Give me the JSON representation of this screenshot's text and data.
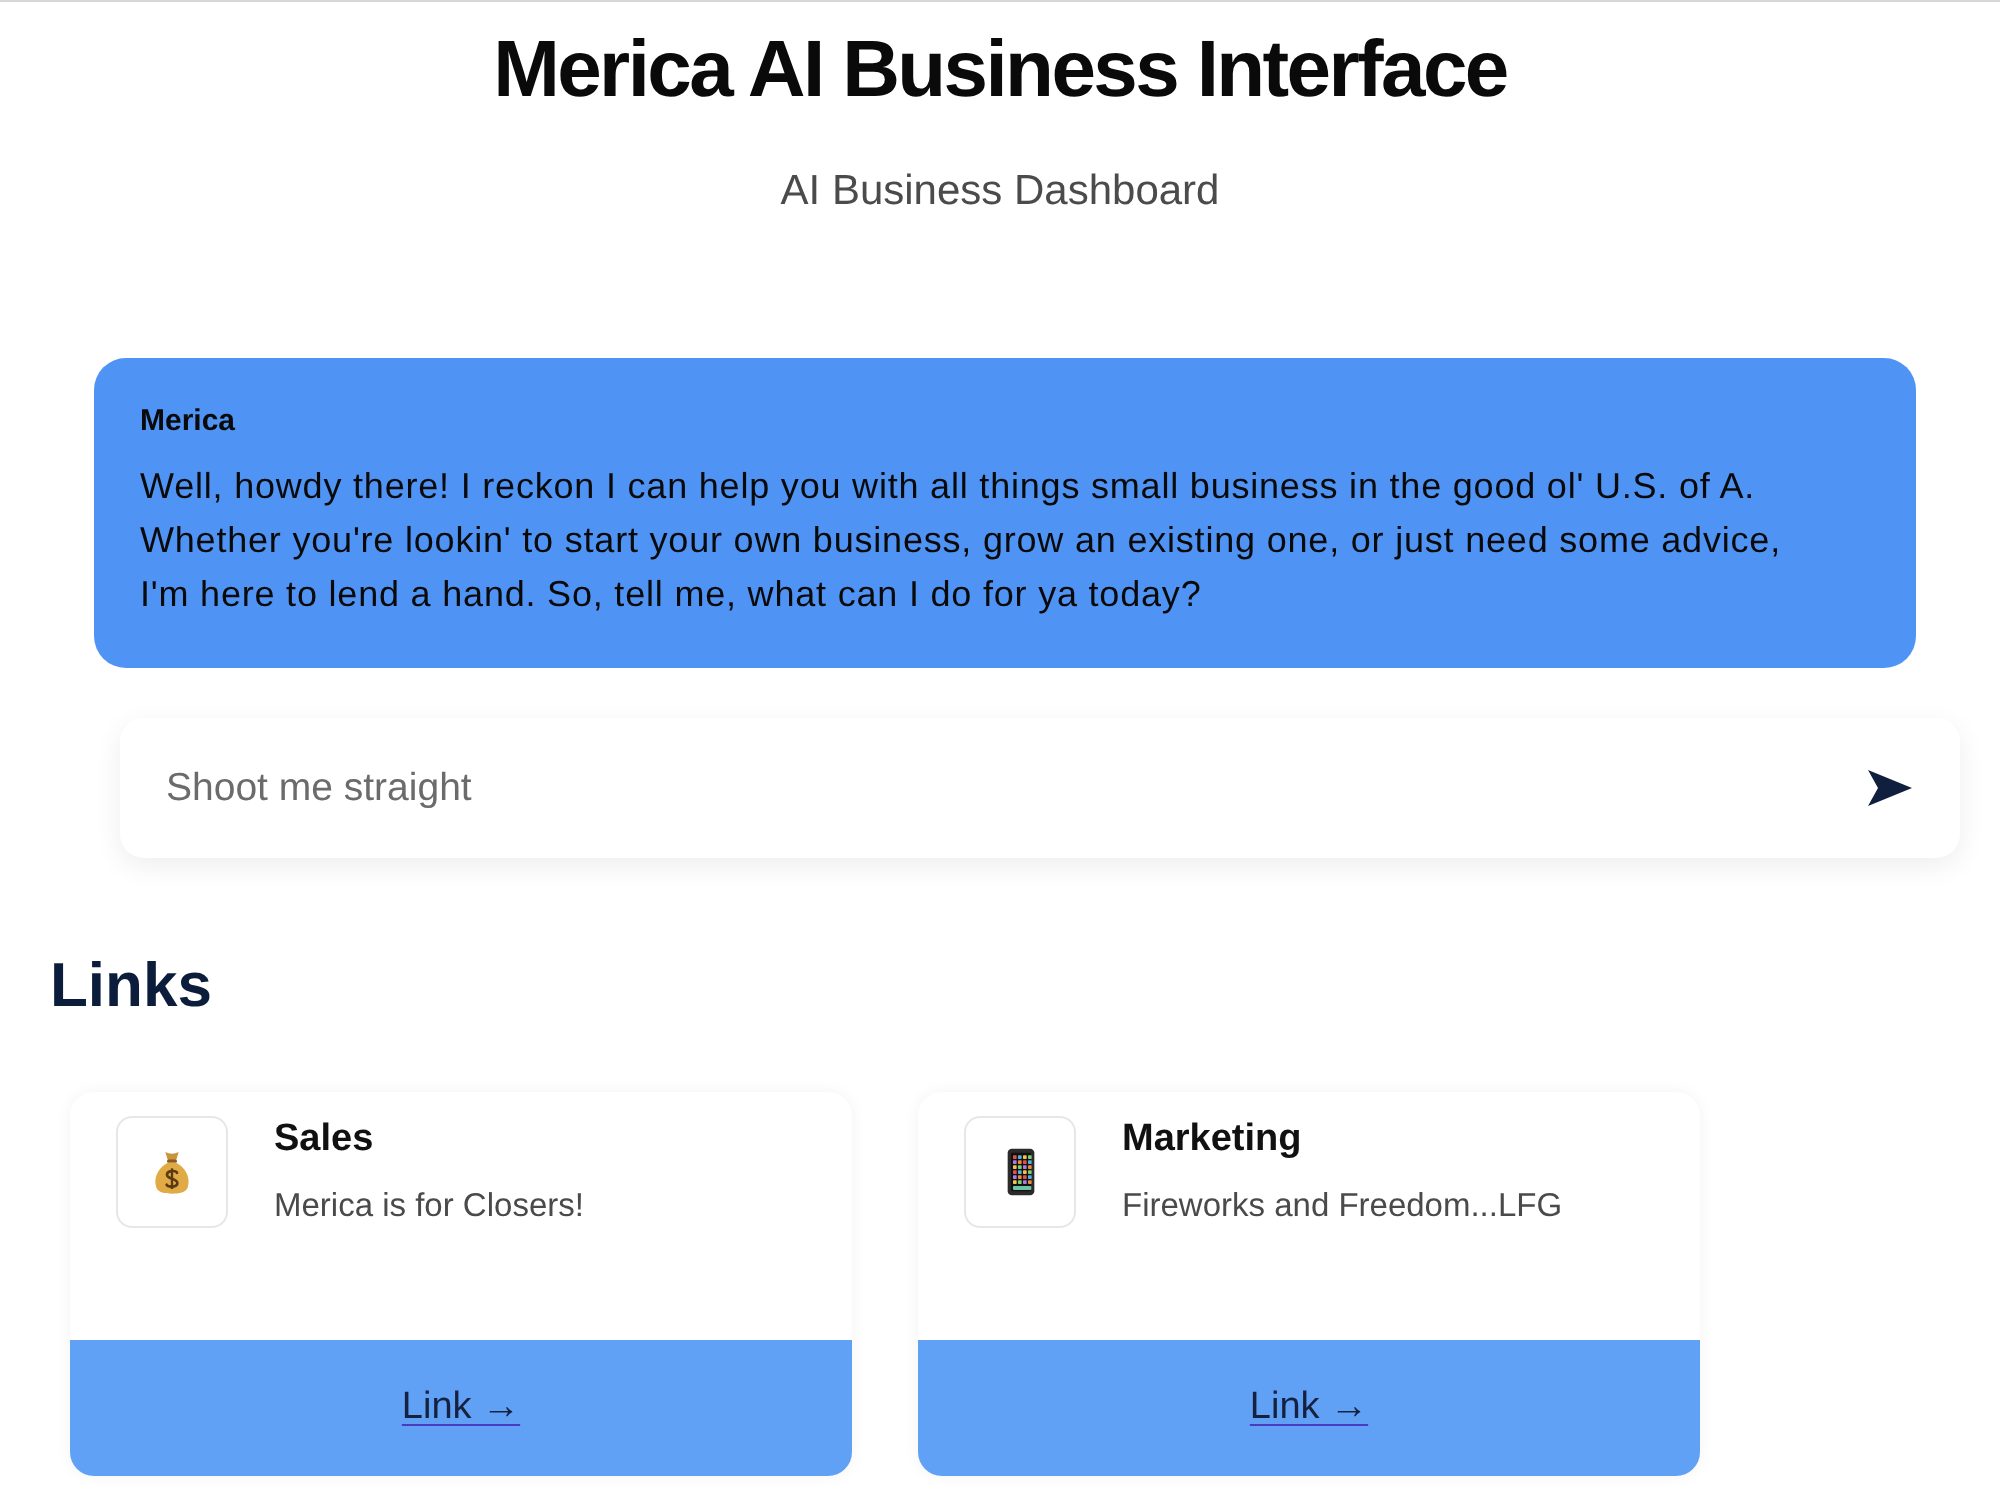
{
  "header": {
    "title": "Merica AI Business Interface",
    "subtitle": "AI Business Dashboard"
  },
  "chat": {
    "messages": [
      {
        "sender": "Merica",
        "text": "Well, howdy there! I reckon I can help you with all things small business in the good ol' U.S. of A. Whether you're lookin' to start your own business, grow an existing one, or just need some advice, I'm here to lend a hand. So, tell me, what can I do for ya today?"
      }
    ]
  },
  "input": {
    "placeholder": "Shoot me straight"
  },
  "links": {
    "heading": "Links",
    "cards": [
      {
        "title": "Sales",
        "description": "Merica is for Closers!",
        "link": "Link →"
      },
      {
        "title": "Marketing",
        "description": "Fireworks and Freedom...LFG",
        "link": "Link →"
      }
    ]
  }
}
